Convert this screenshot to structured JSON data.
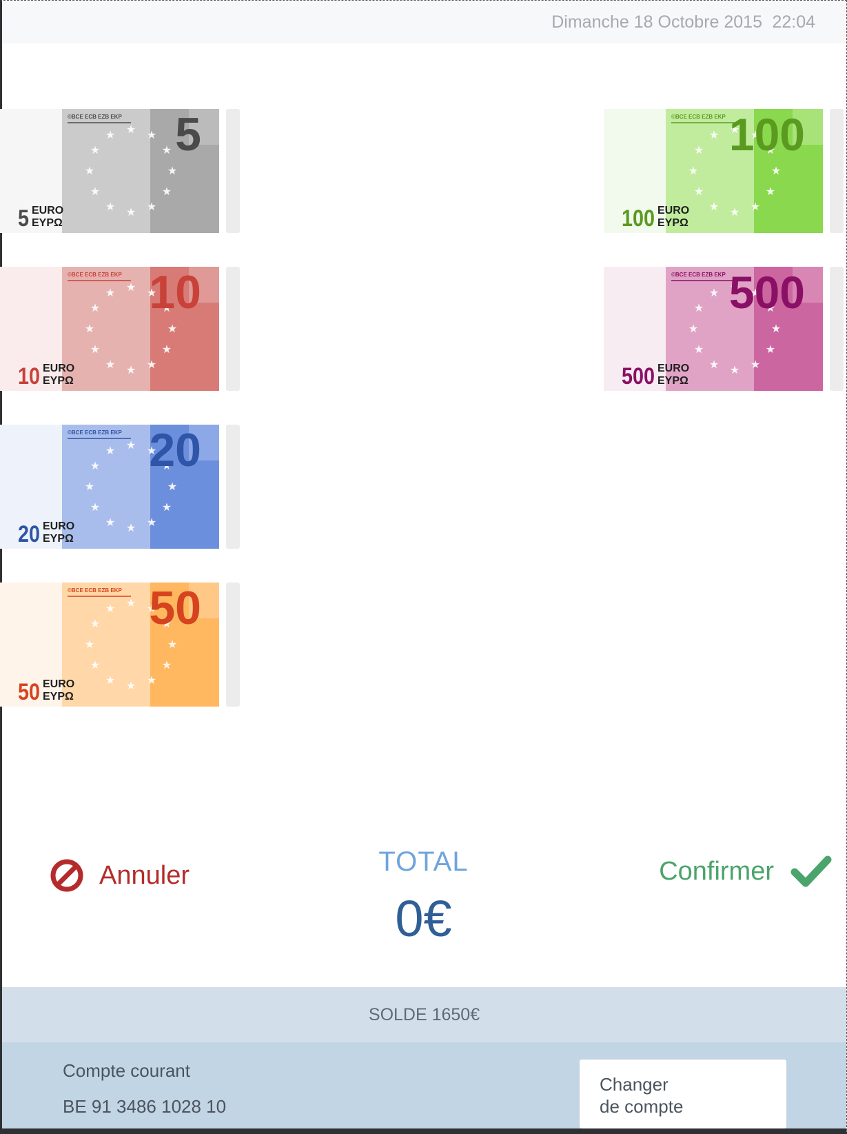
{
  "header": {
    "date": "Dimanche 18 Octobre 2015",
    "time": "22:04"
  },
  "banknotes": [
    {
      "value": "5",
      "currency": "EURO",
      "greek": "EYPΩ",
      "colors": {
        "light": "#f6f6f6",
        "main": "#cbcbcb",
        "dark": "#a9a9a9",
        "text": "#4a4a4a"
      }
    },
    {
      "value": "10",
      "currency": "EURO",
      "greek": "EYPΩ",
      "colors": {
        "light": "#faecec",
        "main": "#e6b2b0",
        "dark": "#d87b76",
        "text": "#c8423a"
      }
    },
    {
      "value": "20",
      "currency": "EURO",
      "greek": "EYPΩ",
      "colors": {
        "light": "#eef3fb",
        "main": "#a9bdec",
        "dark": "#6c8fdd",
        "text": "#2e55a8"
      }
    },
    {
      "value": "50",
      "currency": "EURO",
      "greek": "EYPΩ",
      "colors": {
        "light": "#fff4ea",
        "main": "#ffd7a8",
        "dark": "#ffb760",
        "text": "#d5441e"
      }
    },
    {
      "value": "100",
      "currency": "EURO",
      "greek": "EYPΩ",
      "colors": {
        "light": "#f2faee",
        "main": "#c1ec9e",
        "dark": "#8ad84e",
        "text": "#5a9a1e"
      }
    },
    {
      "value": "500",
      "currency": "EURO",
      "greek": "EYPΩ",
      "colors": {
        "light": "#f8ecf3",
        "main": "#e1a3c5",
        "dark": "#cc66a0",
        "text": "#8a1066"
      }
    }
  ],
  "banknote_header_text": "©BCE ECB EZB EKP",
  "actions": {
    "cancel_label": "Annuler",
    "confirm_label": "Confirmer",
    "cancel_icon": "prohibited-icon",
    "confirm_icon": "checkmark-icon"
  },
  "total": {
    "label": "TOTAL",
    "value": "0€"
  },
  "balance": {
    "text": "SOLDE 1650€"
  },
  "account": {
    "type": "Compte courant",
    "iban": "BE 91 3486 1028 10",
    "change_label": "Changer\nde compte"
  },
  "colors": {
    "cancel": "#b52b2b",
    "confirm": "#4ba46b",
    "total_label": "#6fa4dd",
    "total_value": "#2f5f96",
    "balance_bar": "#d2dfeb",
    "account_bar": "#c2d5e5"
  }
}
